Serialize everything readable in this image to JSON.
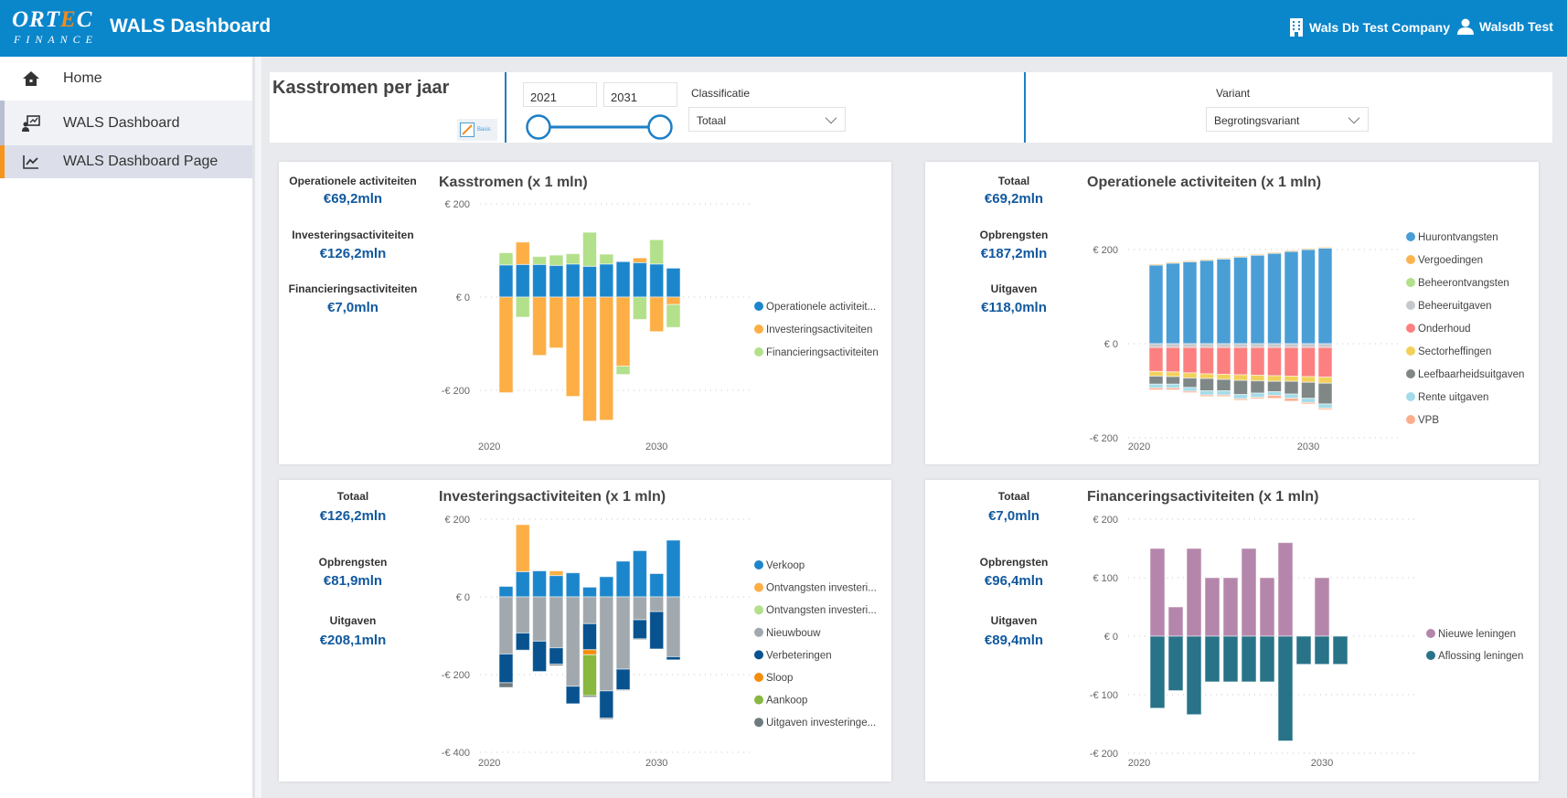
{
  "header": {
    "logo_top": "ORTEC",
    "logo_bottom": "FINANCE",
    "title": "WALS Dashboard",
    "company": "Wals Db Test Company",
    "user": "Walsdb Test",
    "brand_color": "#0a86cb"
  },
  "sidebar": {
    "items": [
      {
        "label": "Home",
        "icon": "home-icon"
      },
      {
        "label": "WALS Dashboard",
        "icon": "presentation-icon"
      },
      {
        "label": "WALS Dashboard Page",
        "icon": "line-chart-icon"
      }
    ]
  },
  "filters": {
    "page_title": "Kasstromen per jaar",
    "basis_label": "Basis",
    "year_from": "2021",
    "year_to": "2031",
    "classificatie_label": "Classificatie",
    "classificatie_value": "Totaal",
    "variant_label": "Variant",
    "variant_value": "Begrotingsvariant"
  },
  "cards": [
    {
      "title": "Kasstromen (x 1 mln)",
      "kpis": [
        {
          "label": "Operationele activiteiten",
          "value": "€69,2mln"
        },
        {
          "label": "Investeringsactiviteiten",
          "value": "€126,2mln"
        },
        {
          "label": "Financieringsactiviteiten",
          "value": "€7,0mln"
        }
      ]
    },
    {
      "title": "Operationele activiteiten (x 1 mln)",
      "kpis": [
        {
          "label": "Totaal",
          "value": "€69,2mln"
        },
        {
          "label": "Opbrengsten",
          "value": "€187,2mln"
        },
        {
          "label": "Uitgaven",
          "value": "€118,0mln"
        }
      ]
    },
    {
      "title": "Investeringsactiviteiten (x 1 mln)",
      "kpis": [
        {
          "label": "Totaal",
          "value": "€126,2mln"
        },
        {
          "label": "Opbrengsten",
          "value": "€81,9mln"
        },
        {
          "label": "Uitgaven",
          "value": "€208,1mln"
        }
      ]
    },
    {
      "title": "Financeringsactiviteiten (x 1 mln)",
      "kpis": [
        {
          "label": "Totaal",
          "value": "€7,0mln"
        },
        {
          "label": "Opbrengsten",
          "value": "€96,4mln"
        },
        {
          "label": "Uitgaven",
          "value": "€89,4mln"
        }
      ]
    }
  ],
  "chart_data": [
    {
      "type": "bar",
      "stacked": true,
      "title": "Kasstromen (x 1 mln)",
      "categories": [
        2021,
        2022,
        2023,
        2024,
        2025,
        2026,
        2027,
        2028,
        2029,
        2030,
        2031
      ],
      "ylim": [
        -300,
        200
      ],
      "yticks": [
        200,
        0,
        -200
      ],
      "ytick_labels": [
        "€ 200",
        "€ 0",
        "-€ 200"
      ],
      "xticks": [
        2020,
        2030
      ],
      "xtick_labels": [
        "2020",
        "2030"
      ],
      "grid": true,
      "legend": "right",
      "series": [
        {
          "name": "Operationele activiteit...",
          "color": "#1c86cc",
          "values": [
            69,
            70,
            70,
            68,
            71,
            66,
            71,
            76,
            74,
            71,
            62
          ]
        },
        {
          "name": "Investeringsactiviteiten",
          "color": "#fdae45",
          "values": [
            -205,
            48,
            -125,
            -109,
            -213,
            -266,
            -264,
            -148,
            10,
            -74,
            -16
          ]
        },
        {
          "name": "Financieringsactiviteiten",
          "color": "#b3e08a",
          "values": [
            26,
            -43,
            17,
            22,
            22,
            73,
            21,
            -18,
            -48,
            52,
            -49
          ]
        }
      ]
    },
    {
      "type": "bar",
      "stacked": true,
      "title": "Operationele activiteiten (x 1 mln)",
      "categories": [
        2021,
        2022,
        2023,
        2024,
        2025,
        2026,
        2027,
        2028,
        2029,
        2030,
        2031
      ],
      "ylim": [
        -200,
        200
      ],
      "yticks": [
        200,
        0,
        -200
      ],
      "ytick_labels": [
        "€ 200",
        "€ 0",
        "-€ 200"
      ],
      "xticks": [
        2020,
        2030
      ],
      "xtick_labels": [
        "2020",
        "2030"
      ],
      "grid": true,
      "legend": "right",
      "series": [
        {
          "name": "Huurontvangsten",
          "color": "#4a9ed6",
          "values": [
            167,
            171,
            174,
            177,
            180,
            184,
            188,
            192,
            196,
            200,
            203
          ]
        },
        {
          "name": "Vergoedingen",
          "color": "#fbb450",
          "values": [
            2,
            2,
            2,
            2,
            2,
            2,
            2,
            2,
            2,
            2,
            2
          ]
        },
        {
          "name": "Beheerontvangsten",
          "color": "#b3e08a",
          "values": [
            0,
            0,
            0,
            0,
            0,
            0,
            0,
            0,
            0,
            0,
            0
          ]
        },
        {
          "name": "Beheeruitgaven",
          "color": "#c5c8cc",
          "values": [
            -8,
            -8,
            -8,
            -8,
            -8,
            -8,
            -8,
            -8,
            -8,
            -8,
            -8
          ]
        },
        {
          "name": "Onderhoud",
          "color": "#fc8080",
          "values": [
            -51,
            -52,
            -54,
            -56,
            -57,
            -58,
            -59,
            -60,
            -61,
            -62,
            -63
          ]
        },
        {
          "name": "Sectorheffingen",
          "color": "#f2d15a",
          "values": [
            -10,
            -10,
            -11,
            -10,
            -11,
            -12,
            -12,
            -12,
            -11,
            -12,
            -13
          ]
        },
        {
          "name": "Leefbaarheidsuitgaven",
          "color": "#7f8787",
          "values": [
            -17,
            -16,
            -20,
            -26,
            -24,
            -30,
            -26,
            -22,
            -27,
            -34,
            -44
          ]
        },
        {
          "name": "Rente uitgaven",
          "color": "#a4dbe8",
          "values": [
            -8,
            -8,
            -8,
            -9,
            -9,
            -9,
            -9,
            -8,
            -9,
            -9,
            -9
          ]
        },
        {
          "name": "VPB",
          "color": "#fcad8c",
          "values": [
            -4,
            -4,
            -3,
            -3,
            -3,
            -3,
            -3,
            -6,
            -6,
            -3,
            -3
          ]
        }
      ]
    },
    {
      "type": "bar",
      "stacked": true,
      "title": "Investeringsactiviteiten (x 1 mln)",
      "categories": [
        2021,
        2022,
        2023,
        2024,
        2025,
        2026,
        2027,
        2028,
        2029,
        2030,
        2031
      ],
      "ylim": [
        -400,
        200
      ],
      "yticks": [
        200,
        0,
        -200,
        -400
      ],
      "ytick_labels": [
        "€ 200",
        "€ 0",
        "-€ 200",
        "-€ 400"
      ],
      "xticks": [
        2020,
        2030
      ],
      "xtick_labels": [
        "2020",
        "2030"
      ],
      "grid": true,
      "legend": "right",
      "series": [
        {
          "name": "Verkoop",
          "color": "#1c86cc",
          "values": [
            27,
            65,
            67,
            55,
            62,
            25,
            52,
            92,
            119,
            60,
            146
          ]
        },
        {
          "name": "Ontvangsten investeri...",
          "color": "#fdae45",
          "values": [
            0,
            121,
            0,
            12,
            0,
            0,
            0,
            0,
            0,
            0,
            0
          ]
        },
        {
          "name": "Ontvangsten investeri...",
          "color": "#b3e08a",
          "values": [
            0,
            0,
            0,
            0,
            0,
            0,
            0,
            0,
            0,
            0,
            0
          ]
        },
        {
          "name": "Nieuwbouw",
          "color": "#a2a9ae",
          "values": [
            -147,
            -93,
            -114,
            -131,
            -230,
            -69,
            -242,
            -186,
            -59,
            -38,
            -154
          ]
        },
        {
          "name": "Verbeteringen",
          "color": "#07528f",
          "values": [
            -74,
            -44,
            -78,
            -42,
            -45,
            -67,
            -70,
            -53,
            -49,
            -96,
            -8
          ]
        },
        {
          "name": "Sloop",
          "color": "#f58c0a",
          "values": [
            0,
            0,
            0,
            0,
            0,
            -13,
            0,
            0,
            0,
            0,
            0
          ]
        },
        {
          "name": "Aankoop",
          "color": "#88b840",
          "values": [
            0,
            0,
            0,
            0,
            0,
            -105,
            0,
            0,
            0,
            0,
            0
          ]
        },
        {
          "name": "Uitgaven investeringe...",
          "color": "#6e7a7e",
          "values": [
            -12,
            0,
            0,
            -4,
            0,
            -4,
            -3,
            -2,
            -2,
            0,
            0
          ]
        }
      ]
    },
    {
      "type": "bar",
      "stacked": true,
      "title": "Financeringsactiviteiten (x 1 mln)",
      "categories": [
        2021,
        2022,
        2023,
        2024,
        2025,
        2026,
        2027,
        2028,
        2029,
        2030,
        2031
      ],
      "ylim": [
        -200,
        200
      ],
      "yticks": [
        200,
        100,
        0,
        -100,
        -200
      ],
      "ytick_labels": [
        "€ 200",
        "€ 100",
        "€ 0",
        "-€ 100",
        "-€ 200"
      ],
      "xticks": [
        2020,
        2030
      ],
      "xtick_labels": [
        "2020",
        "2030"
      ],
      "grid": true,
      "legend": "right",
      "series": [
        {
          "name": "Nieuwe leningen",
          "color": "#b586ab",
          "values": [
            150,
            50,
            150,
            100,
            100,
            150,
            100,
            160,
            0,
            100,
            0
          ]
        },
        {
          "name": "Aflossing leningen",
          "color": "#287388",
          "values": [
            -123,
            -93,
            -134,
            -78,
            -78,
            -78,
            -78,
            -179,
            -48,
            -48,
            -48
          ]
        }
      ]
    }
  ]
}
